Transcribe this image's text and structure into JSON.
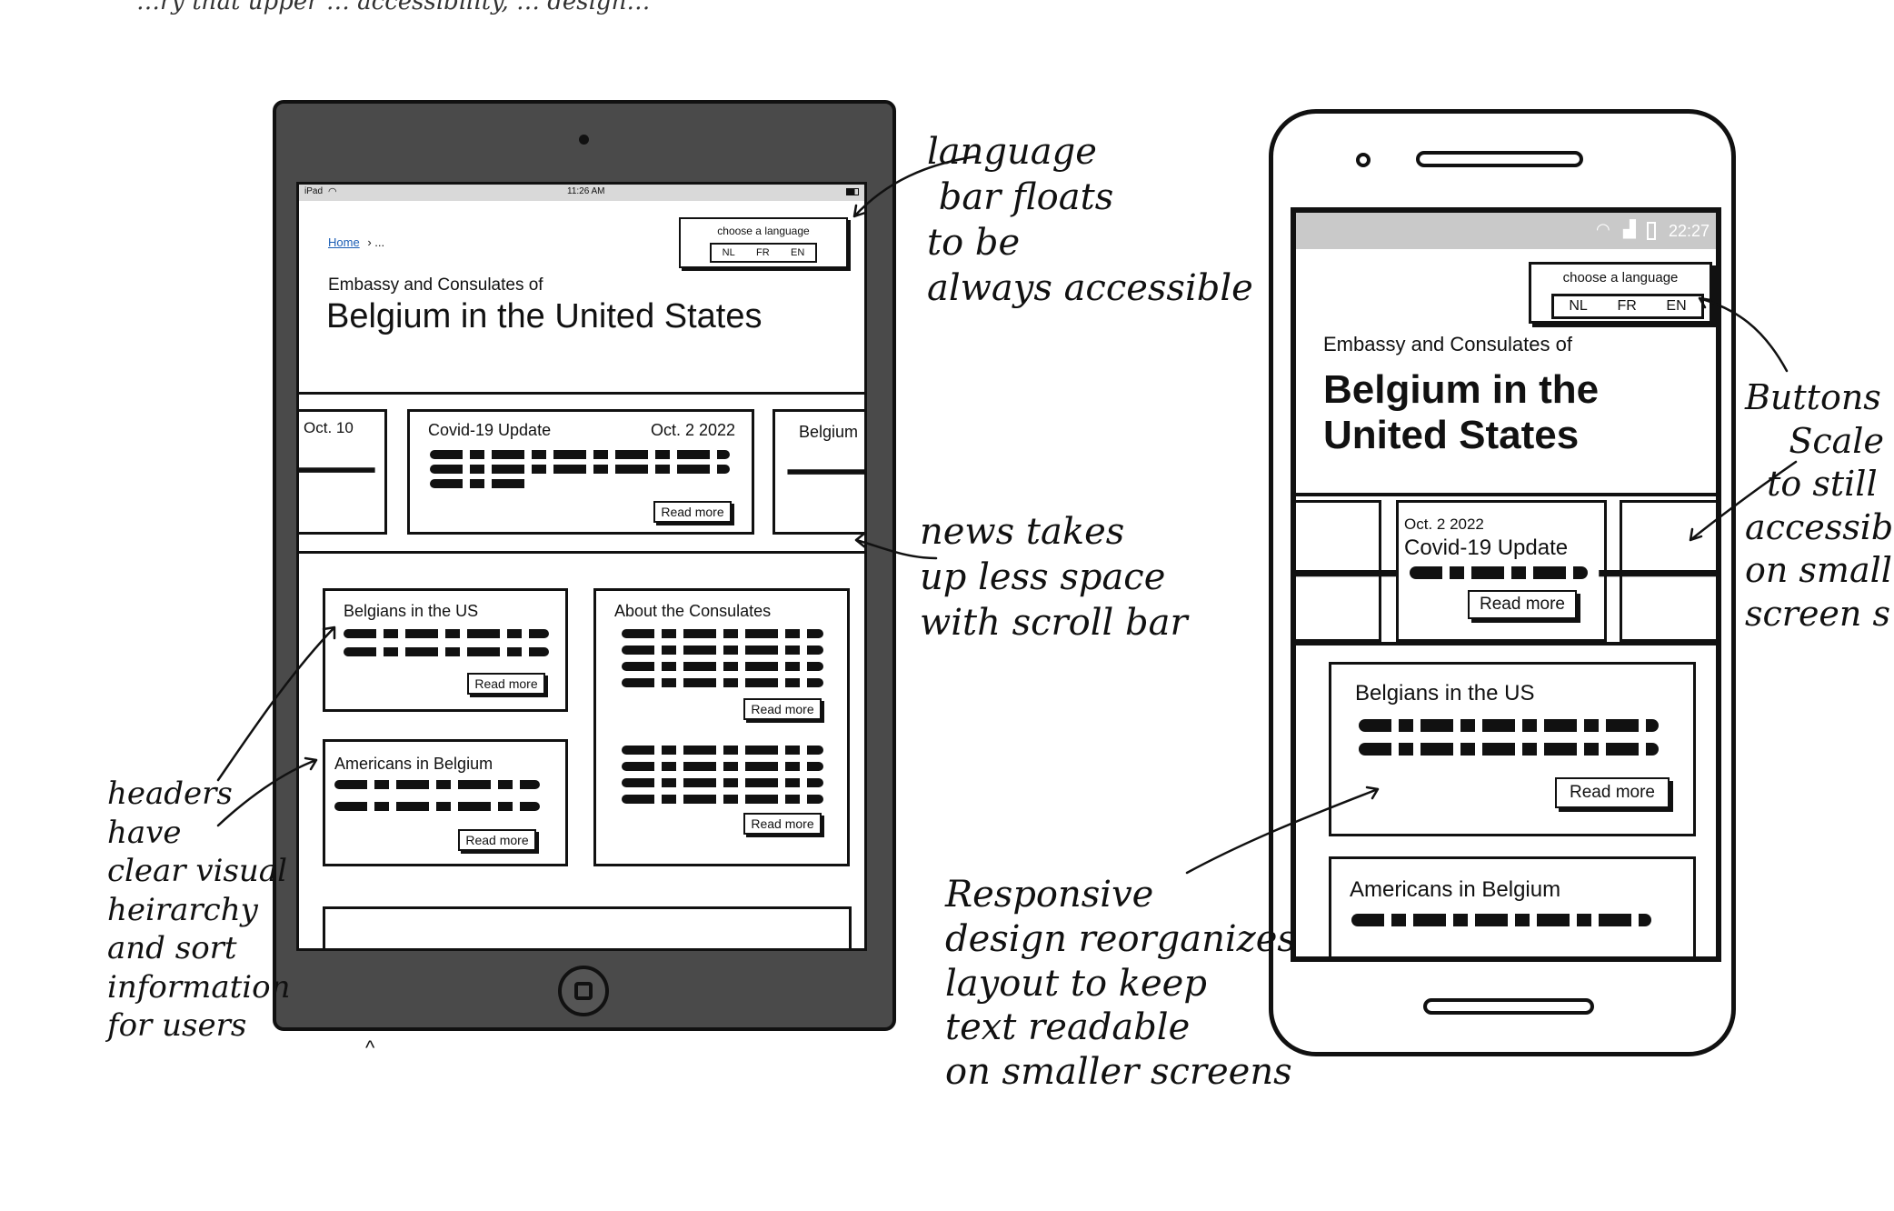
{
  "top_caption": "…ry that upper … accessibility, … design…",
  "tablet": {
    "status": {
      "device": "iPad",
      "time": "11:26 AM"
    },
    "breadcrumb": {
      "home": "Home",
      "sep": "›",
      "ellipsis": "..."
    },
    "language": {
      "title": "choose a language",
      "options": [
        "NL",
        "FR",
        "EN"
      ]
    },
    "subtitle": "Embassy and Consulates of",
    "title": "Belgium in the United States",
    "news": {
      "left_date": "Oct. 10",
      "center_title": "Covid-19 Update",
      "center_date": "Oct. 2 2022",
      "right_title": "Belgium",
      "read_more": "Read more"
    },
    "cards": [
      {
        "title": "Belgians in the US",
        "button": "Read more"
      },
      {
        "title": "About the Consulates",
        "button": "Read more",
        "button2": "Read more"
      },
      {
        "title": "Americans in Belgium",
        "button": "Read more"
      }
    ]
  },
  "phone": {
    "status": {
      "time": "22:27"
    },
    "language": {
      "title": "choose a language",
      "options": [
        "NL",
        "FR",
        "EN"
      ]
    },
    "subtitle": "Embassy and Consulates of",
    "title_line1": "Belgium in the",
    "title_line2": "United States",
    "news": {
      "date": "Oct. 2 2022",
      "title": "Covid-19 Update",
      "read_more": "Read more"
    },
    "cards": [
      {
        "title": "Belgians in the US",
        "button": "Read more"
      },
      {
        "title": "Americans in Belgium"
      }
    ]
  },
  "annotations": {
    "language_bar": "language\n bar floats\nto be\nalways accessible",
    "news": "news takes\nup less space\nwith scroll bar",
    "headers": "headers\nhave\nclear visual\nheirarchy\nand sort\ninformation\nfor users",
    "buttons": "Buttons\n    Scale\n  to still\naccessible\non small\nscreen s",
    "responsive": "Responsive\ndesign reorganizes\nlayout to keep\ntext readable\non smaller screens"
  },
  "colors": {
    "ink": "#111111",
    "tablet_bezel": "#4a4a4a",
    "status_bar": "#d9d9d9",
    "phone_status": "#c9c9c9",
    "link": "#1a5db5"
  }
}
